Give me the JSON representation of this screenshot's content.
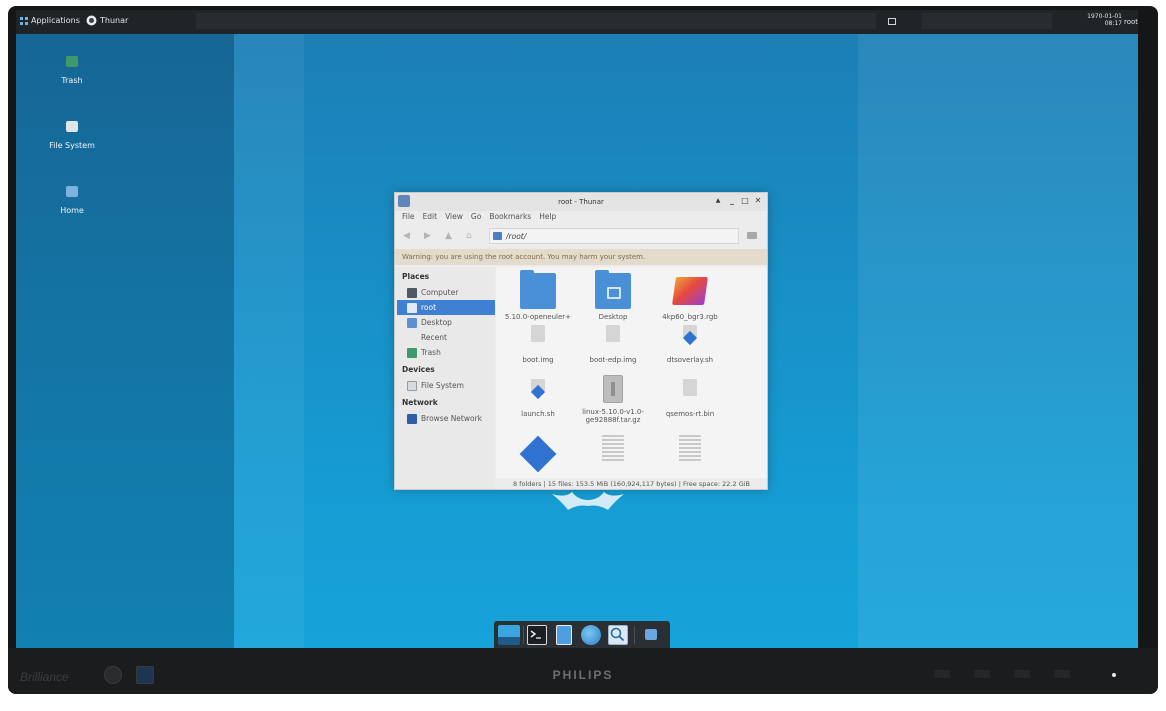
{
  "monitor": {
    "brand_left": "Brilliance",
    "brand_center": "PHILIPS"
  },
  "panel": {
    "applications_label": "Applications",
    "task_label": "Thunar",
    "clock_date": "1970-01-01",
    "clock_time": "08:17",
    "user": "root"
  },
  "desktop": {
    "icons": [
      {
        "label": "Trash",
        "icon": "trash-icon"
      },
      {
        "label": "File System",
        "icon": "drive-icon"
      },
      {
        "label": "Home",
        "icon": "home-folder-icon"
      }
    ]
  },
  "window": {
    "title": "root - Thunar",
    "controls": {
      "shade": "▲",
      "minimize": "_",
      "maximize": "□",
      "close": "✕"
    },
    "menu": [
      "File",
      "Edit",
      "View",
      "Go",
      "Bookmarks",
      "Help"
    ],
    "location": "/root/",
    "warning": "Warning: you are using the root account. You may harm your system.",
    "sidebar": {
      "places_heading": "Places",
      "places": [
        "Computer",
        "root",
        "Desktop",
        "Recent",
        "Trash"
      ],
      "devices_heading": "Devices",
      "devices": [
        "File System"
      ],
      "network_heading": "Network",
      "network": [
        "Browse Network"
      ]
    },
    "files": [
      {
        "name": "5.10.0-openeuler+",
        "kind": "folder"
      },
      {
        "name": "Desktop",
        "kind": "folder-desktop"
      },
      {
        "name": "4kp60_bgr3.rgb",
        "kind": "image"
      },
      {
        "name": "boot.img",
        "kind": "document"
      },
      {
        "name": "boot-edp.img",
        "kind": "document"
      },
      {
        "name": "dtsoverlay.sh",
        "kind": "script"
      },
      {
        "name": "launch.sh",
        "kind": "script"
      },
      {
        "name": "linux-5.10.0-v1.0-ge92888f.tar.gz",
        "kind": "archive"
      },
      {
        "name": "qsemos-rt.bin",
        "kind": "document"
      }
    ],
    "status": "8 folders  |  15 files: 153.5 MiB (160,924,117 bytes)  |  Free space: 22.2 GiB"
  },
  "colors": {
    "selection": "#3f7fd4",
    "folder": "#4a90d9",
    "desktop_blue": "#1890c7",
    "panel": "#1f2427"
  }
}
